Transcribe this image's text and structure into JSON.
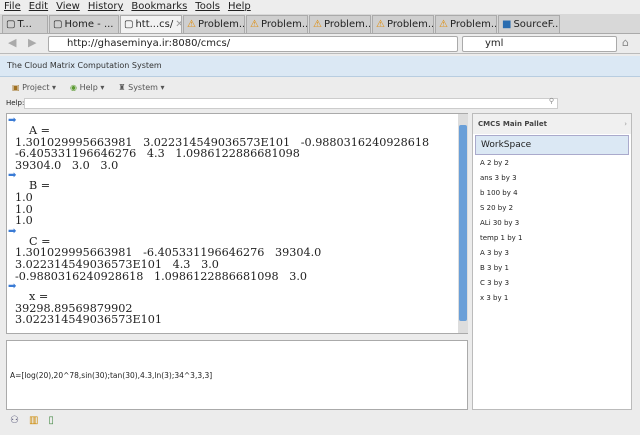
{
  "menu": [
    "File",
    "Edit",
    "View",
    "History",
    "Bookmarks",
    "Tools",
    "Help"
  ],
  "tabs": [
    {
      "label": "T...",
      "icon": "page"
    },
    {
      "label": "Home - ...",
      "icon": "page"
    },
    {
      "label": "htt...cs/",
      "icon": "page",
      "active": true
    },
    {
      "label": "Problem...",
      "icon": "warning"
    },
    {
      "label": "Problem...",
      "icon": "warning"
    },
    {
      "label": "Problem...",
      "icon": "warning"
    },
    {
      "label": "Problem...",
      "icon": "warning"
    },
    {
      "label": "Problem...",
      "icon": "warning"
    },
    {
      "label": "SourceF...",
      "icon": "sf"
    }
  ],
  "url": "http://ghaseminya.ir:8080/cmcs/",
  "search": "yml",
  "app_title": "The Cloud Matrix Computation System",
  "toolbar": {
    "project": "Project",
    "help": "Help",
    "system": "System"
  },
  "help_label": "Help:",
  "console": [
    {
      "name": "A  =",
      "rows": [
        "1.301029995663981   3.022314549036573E101   -0.9880316240928618",
        "-6.405331196646276   4.3   1.0986122886681098",
        "39304.0   3.0   3.0"
      ]
    },
    {
      "name": "B  =",
      "rows": [
        "1.0",
        "1.0",
        "1.0"
      ]
    },
    {
      "name": "C  =",
      "rows": [
        "1.301029995663981   -6.405331196646276   39304.0",
        "3.022314549036573E101   4.3   3.0",
        "-0.9880316240928618   1.0986122886681098   3.0"
      ]
    },
    {
      "name": "x  =",
      "rows": [
        "39298.89569879902",
        "3.022314549036573E101"
      ]
    }
  ],
  "command": "A=[log(20),20^78,sin(30);tan(30),4.3,ln(3);34^3,3,3]",
  "panel": {
    "title": "CMCS Main Pallet",
    "workspace": "WorkSpace",
    "items": [
      "A 2 by 2",
      "ans 3 by 3",
      "b 100 by 4",
      "S 20 by 2",
      "ALi 30 by 3",
      "temp 1 by 1",
      "A 3 by 3",
      "B 3 by 1",
      "C 3 by 3",
      "x 3 by 1"
    ]
  }
}
